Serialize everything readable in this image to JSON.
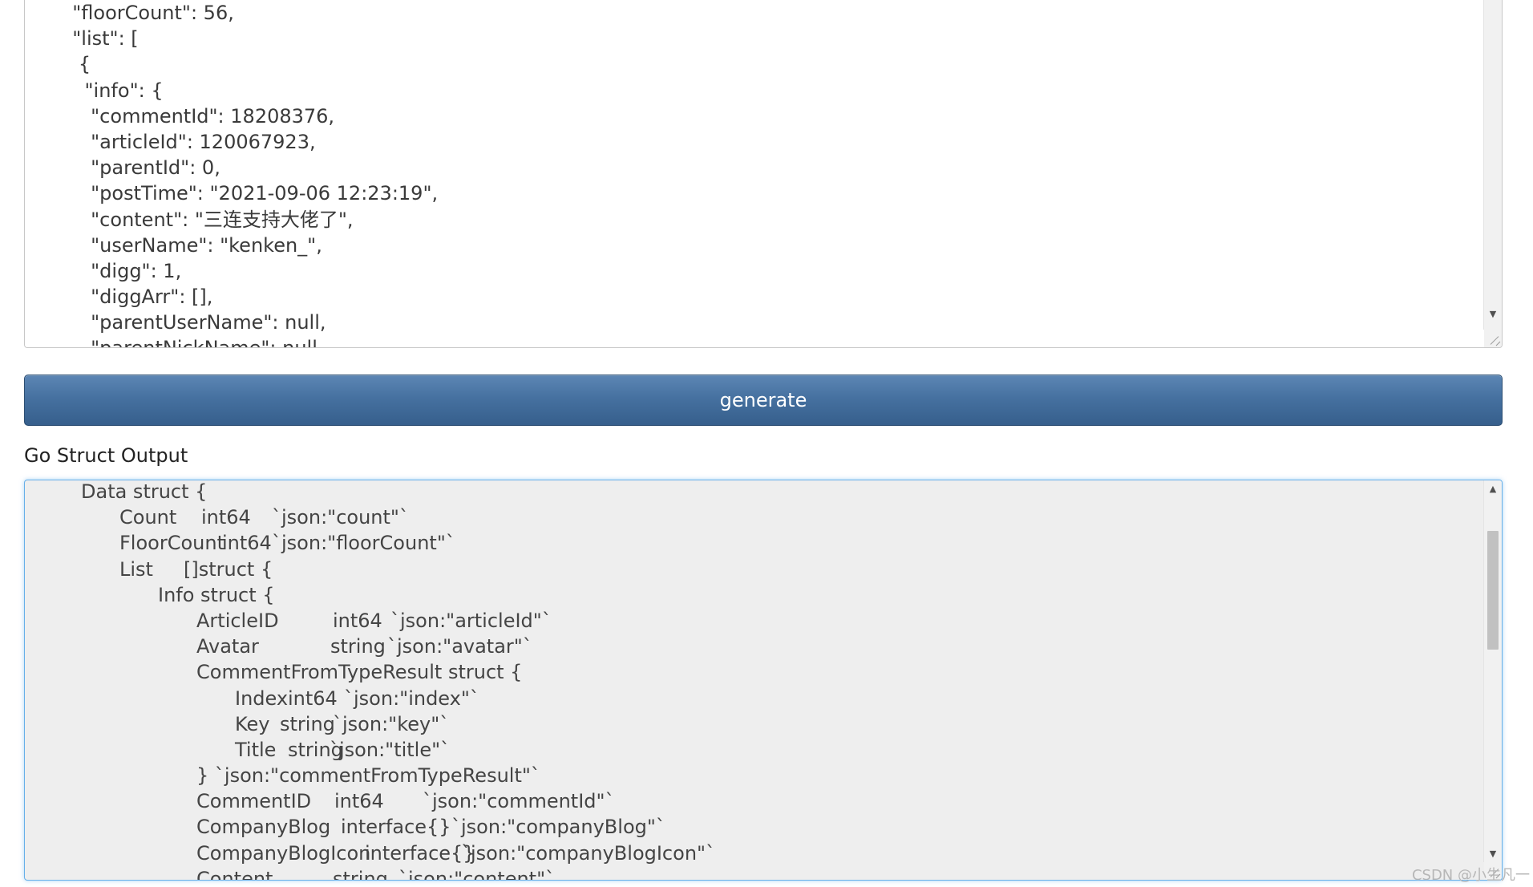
{
  "json_input": {
    "lines": [
      "  \"floorCount\": 56,",
      "  \"list\": [",
      "   {",
      "    \"info\": {",
      "     \"commentId\": 18208376,",
      "     \"articleId\": 120067923,",
      "     \"parentId\": 0,",
      "     \"postTime\": \"2021-09-06 12:23:19\",",
      "     \"content\": \"三连支持大佬了\",",
      "     \"userName\": \"kenken_\",",
      "     \"digg\": 1,",
      "     \"diggArr\": [],",
      "     \"parentUserName\": null,",
      "     \"parentNickName\": null"
    ]
  },
  "generate_button": {
    "label": "generate"
  },
  "output": {
    "label": "Go Struct Output",
    "lines": [
      {
        "indent": 1,
        "cols": [
          "Data struct {"
        ]
      },
      {
        "indent": 2,
        "cols": [
          "Count",
          "int64",
          "`json:\"count\"`"
        ]
      },
      {
        "indent": 2,
        "cols": [
          "FloorCount",
          "int64",
          "`json:\"floorCount\"`"
        ]
      },
      {
        "indent": 2,
        "cols": [
          "List",
          "[]struct {"
        ]
      },
      {
        "indent": 3,
        "cols": [
          "Info struct {"
        ]
      },
      {
        "indent": 4,
        "cols": [
          "ArticleID",
          "int64",
          "`json:\"articleId\"`"
        ]
      },
      {
        "indent": 4,
        "cols": [
          "Avatar",
          "string",
          "`json:\"avatar\"`"
        ]
      },
      {
        "indent": 4,
        "cols": [
          "CommentFromTypeResult struct {"
        ]
      },
      {
        "indent": 5,
        "cols": [
          "Index",
          "int64",
          "`json:\"index\"`"
        ]
      },
      {
        "indent": 5,
        "cols": [
          "Key",
          "string",
          "`json:\"key\"`"
        ]
      },
      {
        "indent": 5,
        "cols": [
          "Title",
          "string",
          "`json:\"title\"`"
        ]
      },
      {
        "indent": 4,
        "cols": [
          "} `json:\"commentFromTypeResult\"`"
        ]
      },
      {
        "indent": 4,
        "cols": [
          "CommentID",
          "int64",
          "`json:\"commentId\"`"
        ]
      },
      {
        "indent": 4,
        "cols": [
          "CompanyBlog",
          "interface{}",
          "`json:\"companyBlog\"`"
        ]
      },
      {
        "indent": 4,
        "cols": [
          "CompanyBlogIcon",
          "interface{}",
          "`json:\"companyBlogIcon\"`"
        ]
      },
      {
        "indent": 4,
        "cols": [
          "Content",
          "string",
          "`json:\"content\"`"
        ]
      }
    ]
  },
  "watermark": {
    "text": "CSDN @小生凡一"
  },
  "icons": {
    "scroll_up": "scroll-up-arrow-icon",
    "scroll_down": "scroll-down-arrow-icon",
    "resize": "resize-grip-icon"
  },
  "colors": {
    "button_top": "#5c86b4",
    "button_bottom": "#365f8c",
    "output_background": "#eeeeee",
    "focus_border": "#66afe9"
  }
}
